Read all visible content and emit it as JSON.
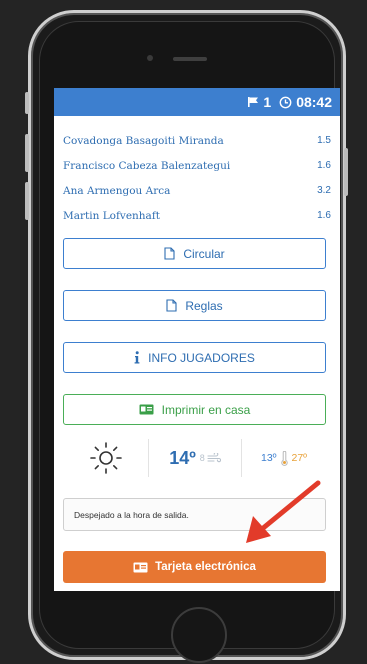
{
  "status": {
    "flag_count": "1",
    "time": "08:42"
  },
  "players": [
    {
      "name": "Covadonga Basagoiti Miranda",
      "hcp": "1.5"
    },
    {
      "name": "Francisco Cabeza Balenzategui",
      "hcp": "1.6"
    },
    {
      "name": "Ana Armengou Arca",
      "hcp": "3.2"
    },
    {
      "name": "Martin Lofvenhaft",
      "hcp": "1.6"
    }
  ],
  "buttons": {
    "circular": "Circular",
    "reglas": "Reglas",
    "info": "INFO JUGADORES",
    "imprimir": "Imprimir en casa",
    "tarjeta": "Tarjeta electrónica"
  },
  "weather": {
    "temp": "14º",
    "wind": "8",
    "min": "13º",
    "max": "27º",
    "description": "Despejado a la hora de salida."
  },
  "colors": {
    "accent_blue": "#3d7fcf",
    "green": "#4aae57",
    "orange": "#e77632",
    "arrow": "#e23b2a"
  },
  "icons": {
    "flag": "flag-icon",
    "clock": "clock-icon",
    "document": "document-icon",
    "info": "info-icon",
    "id_card": "id-card-icon",
    "sun": "sun-icon",
    "wind": "wind-icon",
    "thermometer": "thermometer-icon"
  }
}
